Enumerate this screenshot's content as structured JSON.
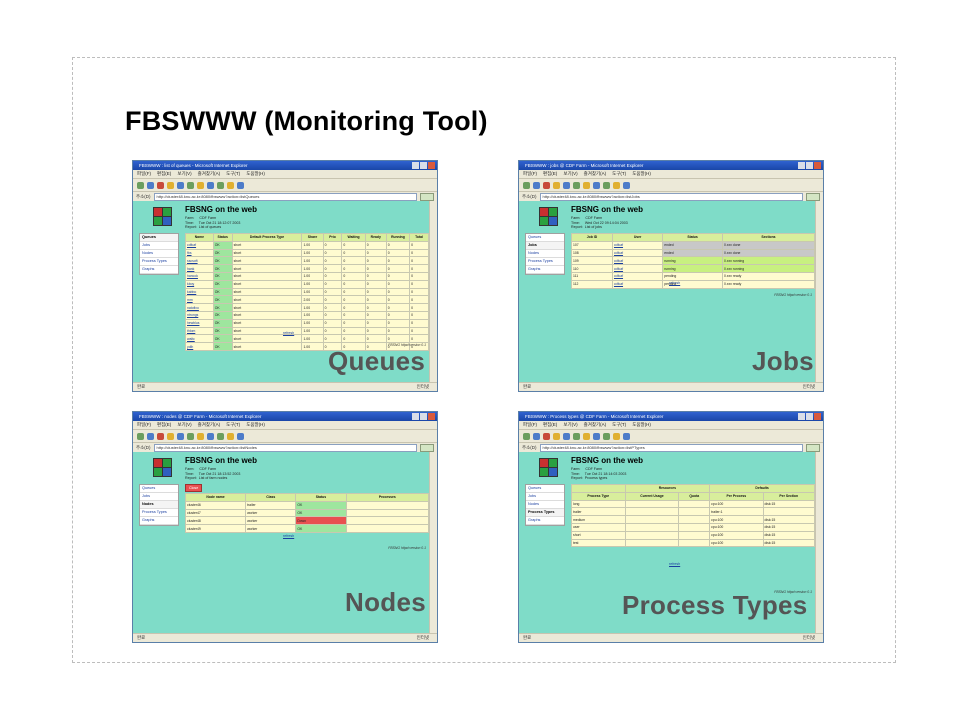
{
  "slide": {
    "title": "FBSWWW (Monitoring Tool)"
  },
  "browser": {
    "menu": [
      "파일(F)",
      "편집(E)",
      "보기(V)",
      "즐겨찾기(A)",
      "도구(T)",
      "도움말(H)"
    ],
    "address_label": "주소(D)",
    "go_label": "이동",
    "status_left": "완료",
    "status_right": "인터넷"
  },
  "page": {
    "heading": "FBSNG on the web",
    "nav": [
      "Queues",
      "Jobs",
      "Nodes",
      "Process Types",
      "Graphs"
    ],
    "refresh": "refresh",
    "version": "FBSNG httpd version 0.1"
  },
  "panels": {
    "queues": {
      "caption": "Queues",
      "window_title": "FBSWWW : list of queues - Microsoft Internet Explorer",
      "url": "http://cluster48.knu.ac.kr:8080/fbswww?action=listQueues",
      "meta": "Farm:     CDF Farm\nTime:     Tue Oct 21 18:12:07 2003\nReport:  List of queues",
      "columns": [
        "Name",
        "Status",
        "Default Process Type",
        "Share",
        "Prio",
        "Waiting",
        "Ready",
        "Running",
        "Total"
      ],
      "rows": [
        [
          "cdfcaf",
          "OK",
          "short",
          "1.00",
          "0",
          "0",
          "0",
          "0",
          "0"
        ],
        [
          "fbs",
          "OK",
          "short",
          "1.00",
          "0",
          "0",
          "0",
          "0",
          "0"
        ],
        [
          "sscsoft",
          "OK",
          "short",
          "1.00",
          "0",
          "0",
          "0",
          "0",
          "0"
        ],
        [
          "hank",
          "OK",
          "short",
          "1.00",
          "0",
          "0",
          "0",
          "0",
          "0"
        ],
        [
          "hancok",
          "OK",
          "short",
          "1.00",
          "0",
          "0",
          "0",
          "0",
          "0"
        ],
        [
          "kboy",
          "OK",
          "short",
          "1.00",
          "0",
          "0",
          "0",
          "0",
          "0"
        ],
        [
          "kabbo",
          "OK",
          "short",
          "1.00",
          "0",
          "0",
          "0",
          "0",
          "0"
        ],
        [
          "mm",
          "OK",
          "short",
          "2.00",
          "0",
          "0",
          "0",
          "0",
          "0"
        ],
        [
          "natofixo",
          "OK",
          "short",
          "1.00",
          "0",
          "0",
          "0",
          "0",
          "0"
        ],
        [
          "ntrongs",
          "OK",
          "short",
          "1.00",
          "0",
          "0",
          "0",
          "0",
          "0"
        ],
        [
          "hewblus",
          "OK",
          "short",
          "1.00",
          "0",
          "0",
          "0",
          "0",
          "0"
        ],
        [
          "thlom",
          "OK",
          "short",
          "1.00",
          "0",
          "0",
          "0",
          "0",
          "0"
        ],
        [
          "waitc",
          "OK",
          "short",
          "1.00",
          "0",
          "0",
          "0",
          "0",
          "0"
        ],
        [
          "ydlh",
          "OK",
          "short",
          "1.00",
          "0",
          "0",
          "0",
          "0",
          "0"
        ]
      ]
    },
    "jobs": {
      "caption": "Jobs",
      "window_title": "FBSWWW : jobs @ CDF Farm - Microsoft Internet Explorer",
      "url": "http://cluster48.knu.ac.kr:8080/fbswww?action=listJobs",
      "meta": "Farm:     CDF Farm\nTime:     Wed Oct 22 09:14:04 2003\nReport:  List of jobs",
      "columns": [
        "Job ID",
        "User",
        "Status",
        "Sections"
      ],
      "rows": [
        [
          "107",
          "cdfcaf",
          "ended",
          "0.xxx done"
        ],
        [
          "108",
          "cdfcaf",
          "ended",
          "0.xxx done"
        ],
        [
          "109",
          "cdfcaf",
          "running",
          "0.xxx running"
        ],
        [
          "110",
          "cdfcaf",
          "running",
          "0.xxx running"
        ],
        [
          "111",
          "cdfcaf",
          "pending",
          "0.xxx ready"
        ],
        [
          "112",
          "cdfcaf",
          "pending",
          "0.xxx ready"
        ]
      ]
    },
    "nodes": {
      "caption": "Nodes",
      "window_title": "FBSWWW : nodes @ CDF Farm - Microsoft Internet Explorer",
      "url": "http://cluster48.knu.ac.kr:8080/fbswww?action=listNodes",
      "meta": "Farm:     CDF Farm\nTime:     Tue Oct 21 18:13:52 2003\nReport:  List of farm nodes",
      "button": "Close",
      "columns": [
        "Node name",
        "Class",
        "Status",
        "Processes"
      ],
      "rows": [
        [
          "cluster46",
          "trailer",
          "OK",
          ""
        ],
        [
          "cluster47",
          "worker",
          "OK",
          ""
        ],
        [
          "cluster48",
          "worker",
          "Down",
          ""
        ],
        [
          "cluster49",
          "worker",
          "OK",
          ""
        ]
      ]
    },
    "process_types": {
      "caption": "Process Types",
      "window_title": "FBSWWW : Process types @ CDF Farm - Microsoft Internet Explorer",
      "url": "http://cluster48.knu.ac.kr:8080/fbswww?action=listPTypes",
      "meta": "Farm:     CDF Farm\nTime:     Tue Oct 21 18:14:03 2003\nReport:  Process types",
      "group_headers": [
        "Resources",
        "Defaults"
      ],
      "columns": [
        "Process Type",
        "Current Usage",
        "Quota",
        "Per Process",
        "Per Section"
      ],
      "rows": [
        [
          "long",
          "",
          "",
          "cpu:100",
          "disk:15"
        ],
        [
          "trailer",
          "",
          "",
          "trailer:1",
          ""
        ],
        [
          "medium",
          "",
          "",
          "cpu:100",
          "disk:15"
        ],
        [
          "user",
          "",
          "",
          "cpu:100",
          "disk:15"
        ],
        [
          "short",
          "",
          "",
          "cpu:100",
          "disk:15"
        ],
        [
          "test",
          "",
          "",
          "cpu:100",
          "disk:15"
        ]
      ]
    }
  }
}
